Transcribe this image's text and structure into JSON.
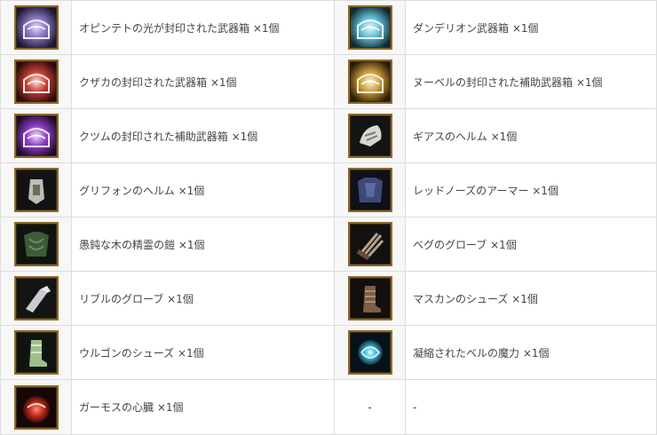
{
  "rows": [
    {
      "left": {
        "icon": "purple-chest-icon",
        "label": "オピンテトの光が封印された武器箱 ×1個"
      },
      "right": {
        "icon": "cyan-chest-icon",
        "label": "ダンデリオン武器箱 ×1個"
      }
    },
    {
      "left": {
        "icon": "red-chest-icon",
        "label": "クザカの封印された武器箱 ×1個"
      },
      "right": {
        "icon": "gold-chest-icon",
        "label": "ヌーベルの封印された補助武器箱 ×1個"
      }
    },
    {
      "left": {
        "icon": "violet-chest-icon",
        "label": "クツムの封印された補助武器箱 ×1個"
      },
      "right": {
        "icon": "bone-helm-icon",
        "label": "ギアスのヘルム ×1個"
      }
    },
    {
      "left": {
        "icon": "griffon-helm-icon",
        "label": "グリフォンのヘルム ×1個"
      },
      "right": {
        "icon": "blue-armor-icon",
        "label": "レッドノーズのアーマー ×1個"
      }
    },
    {
      "left": {
        "icon": "green-armor-icon",
        "label": "愚鈍な木の精霊の鎧 ×1個"
      },
      "right": {
        "icon": "claw-glove-icon",
        "label": "ベグのグローブ ×1個"
      }
    },
    {
      "left": {
        "icon": "silver-glove-icon",
        "label": "リブルのグローブ ×1個"
      },
      "right": {
        "icon": "leather-boots-icon",
        "label": "マスカンのシューズ ×1個"
      }
    },
    {
      "left": {
        "icon": "green-boots-icon",
        "label": "ウルゴンのシューズ ×1個"
      },
      "right": {
        "icon": "blue-orb-icon",
        "label": "凝縮されたベルの魔力 ×1個"
      }
    },
    {
      "left": {
        "icon": "red-heart-icon",
        "label": "ガーモスの心臓 ×1個"
      },
      "right": {
        "icon": "",
        "icon_placeholder": "-",
        "label": "-"
      }
    }
  ]
}
